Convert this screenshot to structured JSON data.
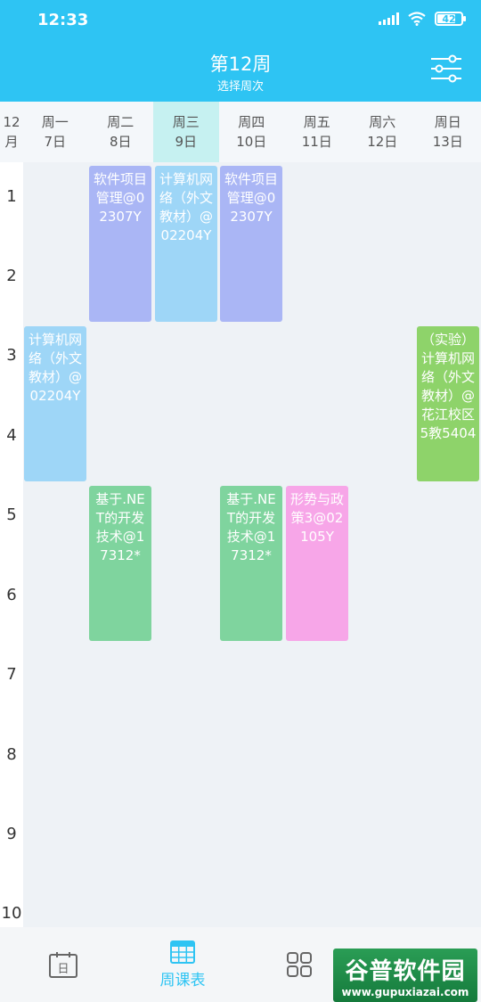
{
  "status": {
    "time": "12:33",
    "battery": "42"
  },
  "header": {
    "title": "第12周",
    "subtitle": "选择周次"
  },
  "month": {
    "num": "12",
    "unit": "月"
  },
  "days": [
    {
      "name": "周一",
      "date": "7日"
    },
    {
      "name": "周二",
      "date": "8日"
    },
    {
      "name": "周三",
      "date": "9日"
    },
    {
      "name": "周四",
      "date": "10日"
    },
    {
      "name": "周五",
      "date": "11日"
    },
    {
      "name": "周六",
      "date": "12日"
    },
    {
      "name": "周日",
      "date": "13日"
    }
  ],
  "periods": [
    "1",
    "2",
    "3",
    "4",
    "5",
    "6",
    "7",
    "8",
    "9",
    "10"
  ],
  "courses": [
    {
      "text": "软件项目管理@02307Y",
      "color": "#aab6f5"
    },
    {
      "text": "计算机网络（外文教材）@02204Y",
      "color": "#9ed6f7"
    },
    {
      "text": "软件项目管理@02307Y",
      "color": "#aab6f5"
    },
    {
      "text": "计算机网络（外文教材）@02204Y",
      "color": "#9ed6f7"
    },
    {
      "text": "（实验）计算机网络（外文教材）@花江校区5教5404",
      "color": "#8ed36a"
    },
    {
      "text": "基于.NET的开发技术@17312*",
      "color": "#7fd49e"
    },
    {
      "text": "基于.NET的开发技术@17312*",
      "color": "#7fd49e"
    },
    {
      "text": "形势与政策3@02105Y",
      "color": "#f7a6e8"
    }
  ],
  "nav": {
    "active_label": "周课表"
  },
  "watermark": {
    "big": "谷普软件园",
    "small": "www.gupuxiazai.com"
  }
}
